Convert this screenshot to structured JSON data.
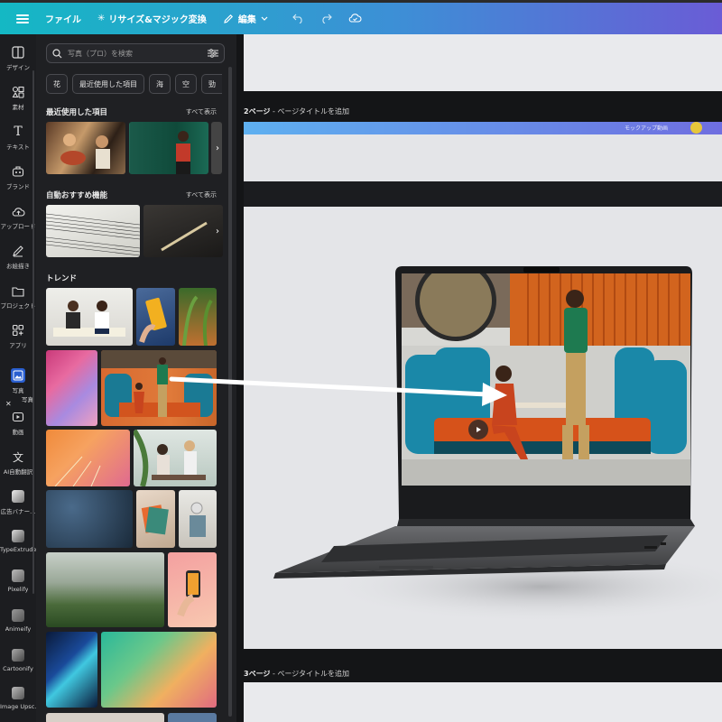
{
  "topbar": {
    "menu_icon": "hamburger-icon",
    "file": "ファイル",
    "resize": "リサイズ&マジック変換",
    "edit": "編集",
    "undo_icon": "undo-icon",
    "redo_icon": "redo-icon",
    "cloud_icon": "cloud-sync-icon"
  },
  "nav": {
    "items": [
      {
        "label": "デザイン",
        "icon": "design-icon"
      },
      {
        "label": "素材",
        "icon": "elements-icon"
      },
      {
        "label": "テキスト",
        "icon": "text-icon"
      },
      {
        "label": "ブランド",
        "icon": "brand-icon"
      },
      {
        "label": "アップロード",
        "icon": "upload-icon"
      },
      {
        "label": "お絵描き",
        "icon": "draw-icon"
      },
      {
        "label": "プロジェクト",
        "icon": "folder-icon"
      },
      {
        "label": "アプリ",
        "icon": "apps-icon"
      },
      {
        "label": "写真",
        "icon": "photo-icon"
      },
      {
        "label": "動画",
        "icon": "video-icon"
      },
      {
        "label": "AI自動翻訳",
        "icon": "translate-icon"
      },
      {
        "label": "広告バナー...",
        "icon": "ad-banner-icon"
      },
      {
        "label": "TypeExtrude",
        "icon": "typeextrude-icon"
      },
      {
        "label": "Pixelify",
        "icon": "pixelify-icon"
      },
      {
        "label": "Animeify",
        "icon": "animeify-icon"
      },
      {
        "label": "Cartoonify",
        "icon": "cartoonify-icon"
      },
      {
        "label": "Image Upsc...",
        "icon": "image-upscale-icon"
      }
    ],
    "tooltip": "写真"
  },
  "panel": {
    "search_placeholder": "写真（プロ）を検索",
    "chips": [
      "花",
      "最近使用した項目",
      "海",
      "空",
      "勁"
    ],
    "recent_title": "最近使用した項目",
    "recent_see_all": "すべて表示",
    "auto_title": "自動おすすめ機能",
    "auto_see_all": "すべて表示",
    "trend_title": "トレンド"
  },
  "canvas": {
    "page2_label_num": "2ページ",
    "page2_label_rest": " - ページタイトルを追加",
    "page3_label_num": "3ページ",
    "page3_label_rest": " - ページタイトルを追加",
    "strip_text": "モックアップ動画"
  },
  "colors": {
    "topbar_start": "#14b8c4",
    "topbar_end": "#6a5cd6",
    "active_nav": "#2a5fd0"
  }
}
